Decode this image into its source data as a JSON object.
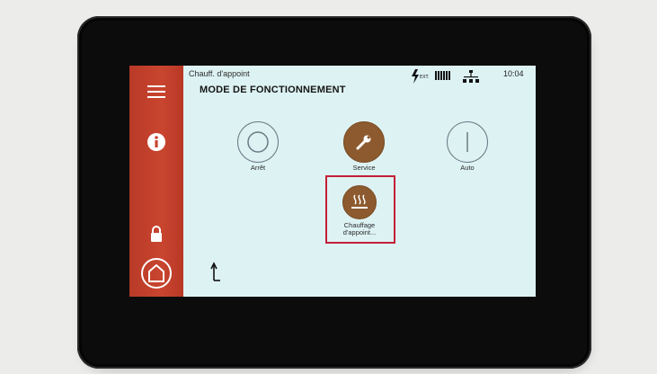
{
  "header": {
    "breadcrumb": "Chauff. d'appoint",
    "title": "MODE DE FONCTIONNEMENT",
    "signal_label": "EXT.",
    "time": "10:04"
  },
  "sidebar": {
    "items": [
      {
        "icon": "menu-icon"
      },
      {
        "icon": "info-icon"
      },
      {
        "icon": "lock-icon"
      },
      {
        "icon": "home-icon"
      }
    ]
  },
  "modes": {
    "arret": {
      "label": "Arrêt",
      "icon": "power-off-icon"
    },
    "service": {
      "label": "Service",
      "icon": "wrench-icon"
    },
    "auto": {
      "label": "Auto",
      "icon": "power-on-icon"
    },
    "chauffage": {
      "label_line1": "Chauffage",
      "label_line2": "d'appoint...",
      "icon": "heating-icon",
      "highlighted": true
    }
  },
  "colors": {
    "sidebar": "#c9452f",
    "screen_bg": "#ddf2f3",
    "active_mode": "#8c5a2e",
    "highlight": "#c41e38"
  }
}
